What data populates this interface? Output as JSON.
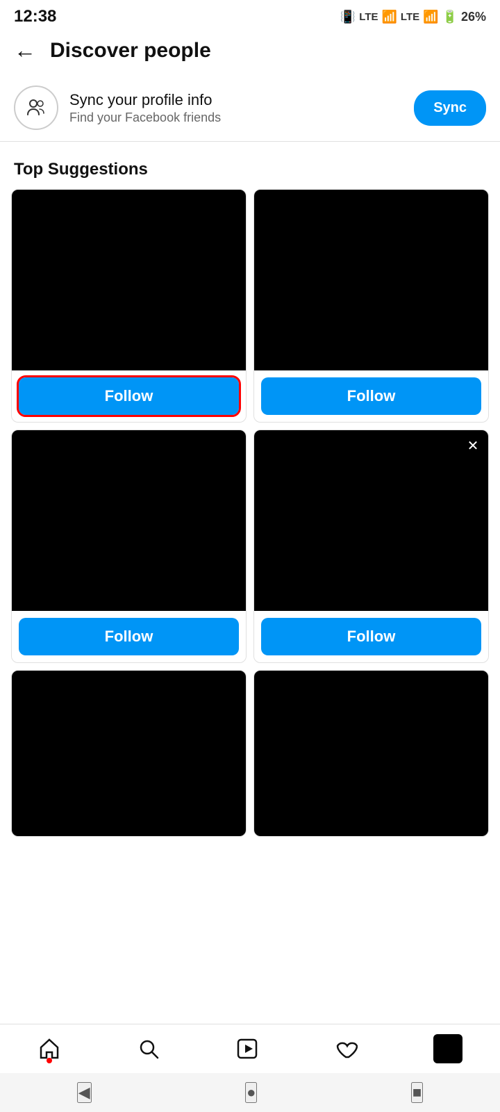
{
  "statusBar": {
    "time": "12:38",
    "battery": "26%",
    "icons": "📳 LTE LTE"
  },
  "header": {
    "backLabel": "←",
    "title": "Discover people"
  },
  "syncBanner": {
    "title": "Sync your profile info",
    "subtitle": "Find your Facebook friends",
    "buttonLabel": "Sync"
  },
  "sectionTitle": "Top Suggestions",
  "cards": [
    {
      "id": 1,
      "followLabel": "Follow",
      "highlighted": true,
      "hasClose": false
    },
    {
      "id": 2,
      "followLabel": "Follow",
      "highlighted": false,
      "hasClose": false
    },
    {
      "id": 3,
      "followLabel": "Follow",
      "highlighted": false,
      "hasClose": false
    },
    {
      "id": 4,
      "followLabel": "Follow",
      "highlighted": false,
      "hasClose": true
    },
    {
      "id": 5,
      "followLabel": "",
      "highlighted": false,
      "hasClose": false,
      "partial": true
    },
    {
      "id": 6,
      "followLabel": "",
      "highlighted": false,
      "hasClose": false,
      "partial": true
    }
  ],
  "bottomNav": {
    "items": [
      {
        "name": "home",
        "icon": "⌂"
      },
      {
        "name": "search",
        "icon": "🔍"
      },
      {
        "name": "reels",
        "icon": "▶"
      },
      {
        "name": "heart",
        "icon": "♡"
      },
      {
        "name": "profile",
        "icon": ""
      }
    ]
  },
  "androidNav": {
    "back": "◀",
    "home": "●",
    "recent": "■"
  }
}
